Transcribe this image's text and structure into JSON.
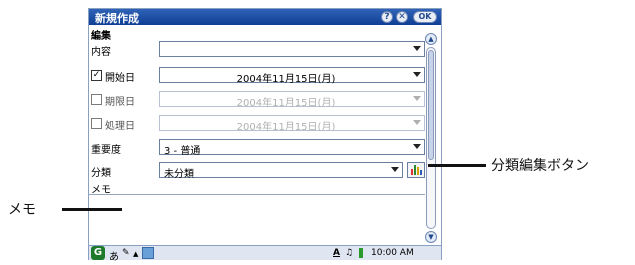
{
  "window": {
    "title": "新規作成",
    "help_glyph": "?",
    "close_glyph": "✕",
    "ok_label": "OK"
  },
  "section": {
    "title": "編集"
  },
  "fields": {
    "content_label": "内容",
    "content_value": "",
    "start_label": "開始日",
    "start_checked": true,
    "start_value": "2004年11月15日(月)",
    "due_label": "期限日",
    "due_checked": false,
    "due_value": "2004年11月15日(月)",
    "done_label": "処理日",
    "done_checked": false,
    "done_value": "2004年11月15日(月)",
    "priority_label": "重要度",
    "priority_value": "3 - 普通",
    "category_label": "分類",
    "category_value": "未分類",
    "memo_label": "メモ",
    "memo_value": ""
  },
  "taskbar": {
    "start_icon": "g-logo-icon",
    "input_mode": "あ",
    "clock": "10:00 AM"
  },
  "annotations": {
    "category_edit_button": "分類編集ボタン",
    "memo": "メモ"
  },
  "colors": {
    "titlebar": "#1f4fa6",
    "accent": "#2f63b8",
    "field_border": "#6b7f9f",
    "taskbar": "#dfe6f1"
  }
}
